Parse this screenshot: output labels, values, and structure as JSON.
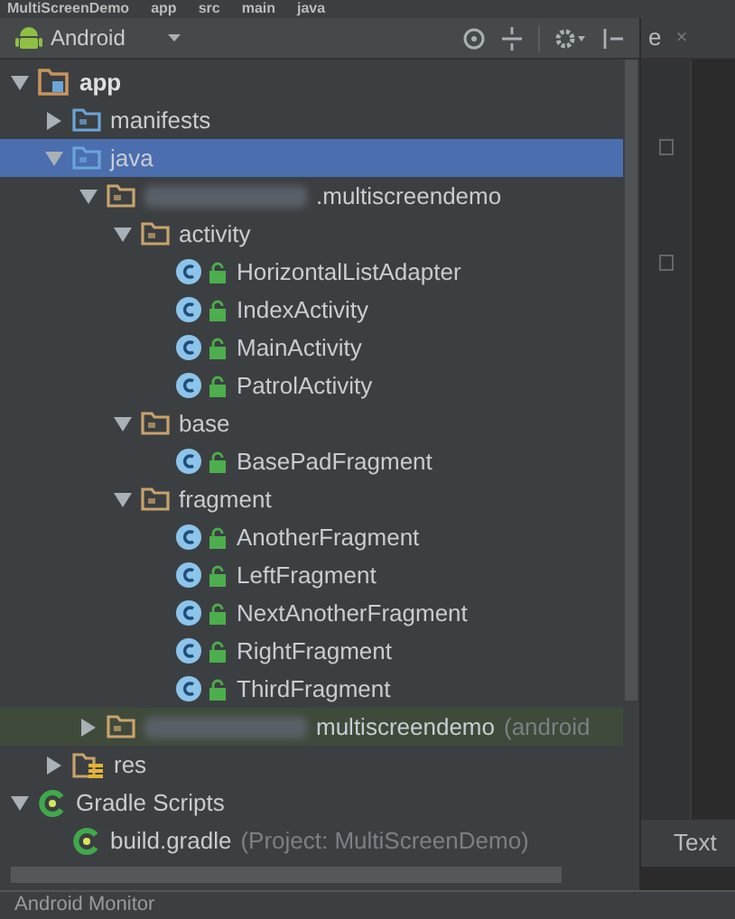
{
  "breadcrumbs": [
    "MultiScreenDemo",
    "app",
    "src",
    "main",
    "java"
  ],
  "project_panel": {
    "view_selector": "Android",
    "tree": [
      {
        "kind": "module",
        "label": "app",
        "expanded": true,
        "selected": false,
        "children": [
          {
            "kind": "folder",
            "label": "manifests",
            "expanded": false,
            "selected": false
          },
          {
            "kind": "folder",
            "label": "java",
            "expanded": true,
            "selected": true,
            "children": [
              {
                "kind": "package",
                "label": ".multiscreendemo",
                "expanded": true,
                "selected": false,
                "children": [
                  {
                    "kind": "package_folder",
                    "label": "activity",
                    "expanded": true,
                    "selected": false,
                    "children": [
                      {
                        "kind": "class",
                        "label": "HorizontalListAdapter",
                        "selected": false
                      },
                      {
                        "kind": "class",
                        "label": "IndexActivity",
                        "selected": false
                      },
                      {
                        "kind": "class",
                        "label": "MainActivity",
                        "selected": false
                      },
                      {
                        "kind": "class",
                        "label": "PatrolActivity",
                        "selected": false
                      }
                    ]
                  },
                  {
                    "kind": "package_folder",
                    "label": "base",
                    "expanded": true,
                    "selected": false,
                    "children": [
                      {
                        "kind": "class",
                        "label": "BasePadFragment",
                        "selected": false
                      }
                    ]
                  },
                  {
                    "kind": "package_folder",
                    "label": "fragment",
                    "expanded": true,
                    "selected": false,
                    "children": [
                      {
                        "kind": "class",
                        "label": "AnotherFragment",
                        "selected": false
                      },
                      {
                        "kind": "class",
                        "label": "LeftFragment",
                        "selected": false
                      },
                      {
                        "kind": "class",
                        "label": "NextAnotherFragment",
                        "selected": false
                      },
                      {
                        "kind": "class",
                        "label": "RightFragment",
                        "selected": false
                      },
                      {
                        "kind": "class",
                        "label": "ThirdFragment",
                        "selected": false
                      }
                    ]
                  }
                ]
              },
              {
                "kind": "test_package",
                "label": "multiscreendemo",
                "suffix": "(android",
                "expanded": false,
                "selected": false
              }
            ]
          },
          {
            "kind": "res",
            "label": "res",
            "expanded": false,
            "selected": false
          }
        ]
      },
      {
        "kind": "gradle_group",
        "label": "Gradle Scripts",
        "expanded": true,
        "selected": false,
        "children": [
          {
            "kind": "gradle_file",
            "label": "build.gradle",
            "suffix": "(Project: MultiScreenDemo)",
            "selected": false
          }
        ]
      }
    ]
  },
  "editor": {
    "tab_label": "e",
    "tab_close": "×",
    "bottom_tab": "Text"
  },
  "bottom_bar": {
    "title": "Android Monitor"
  }
}
